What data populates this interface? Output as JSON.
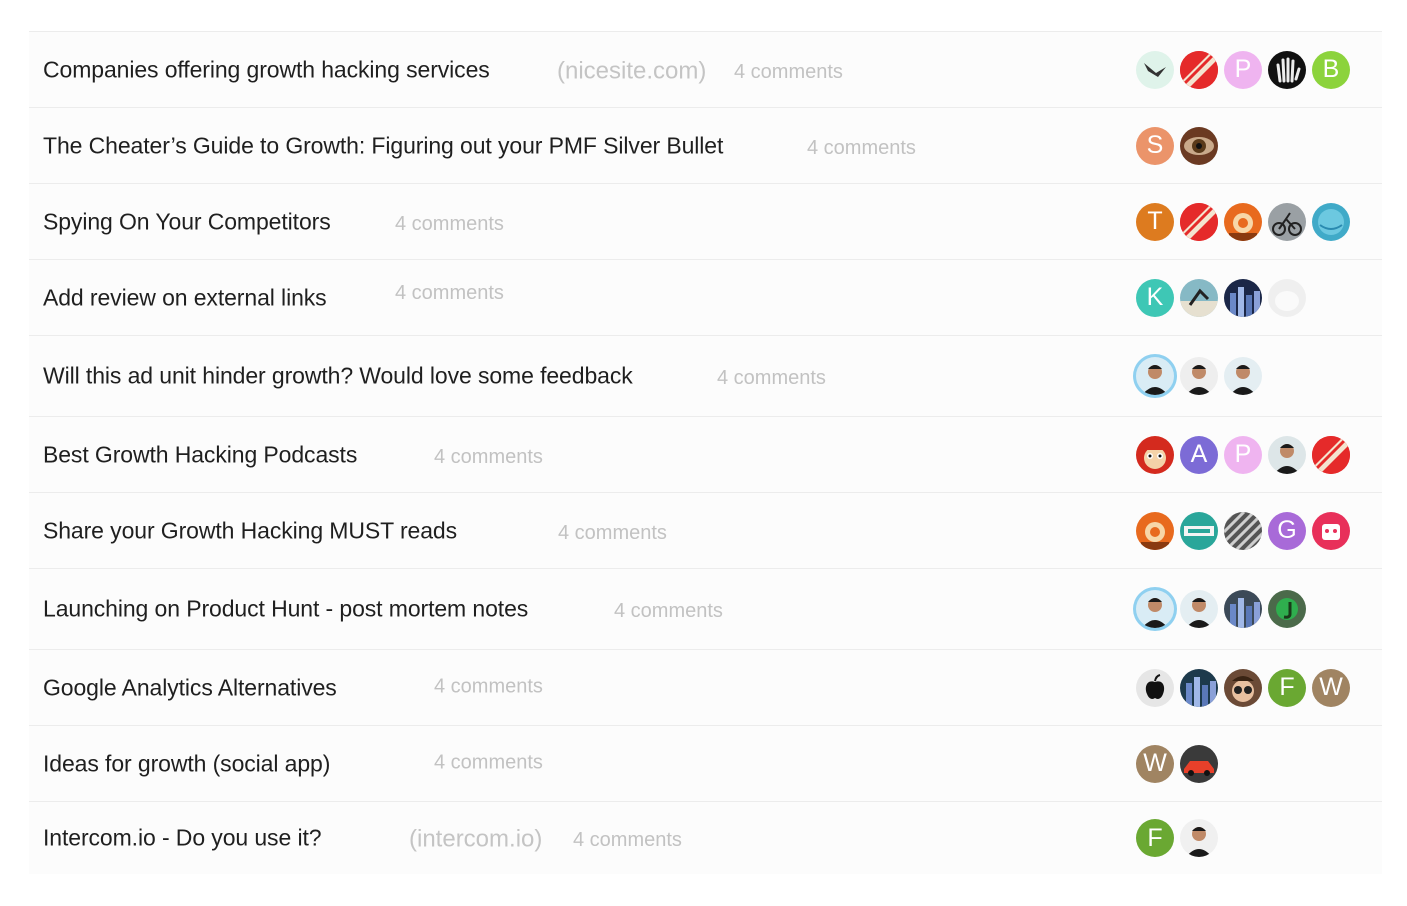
{
  "threads": [
    {
      "title": "Companies offering growth hacking services",
      "domain": "(nicesite.com)",
      "comments": "4 comments",
      "avatars": [
        {
          "kind": "bird-avatar",
          "bg": "#dff3ea"
        },
        {
          "kind": "red-stripe-avatar",
          "bg": "#e52a2a"
        },
        {
          "kind": "letter",
          "letter": "P",
          "bg": "#efb4f0"
        },
        {
          "kind": "hand-avatar",
          "bg": "#111111"
        },
        {
          "kind": "letter",
          "letter": "B",
          "bg": "#8cd33c"
        }
      ]
    },
    {
      "title": "The Cheater’s Guide to Growth: Figuring out your PMF Silver Bullet",
      "domain": "",
      "comments": "4 comments",
      "avatars": [
        {
          "kind": "letter",
          "letter": "S",
          "bg": "#eb946a"
        },
        {
          "kind": "eye-avatar",
          "bg": "#6b3a22"
        }
      ]
    },
    {
      "title": "Spying On Your Competitors",
      "domain": "",
      "comments": "4 comments",
      "avatars": [
        {
          "kind": "letter",
          "letter": "T",
          "bg": "#dd7b1f"
        },
        {
          "kind": "red-stripe-avatar",
          "bg": "#e52a2a"
        },
        {
          "kind": "cartoon-avatar",
          "bg": "#e86a1e"
        },
        {
          "kind": "cyclist-avatar",
          "bg": "#9aa0a4"
        },
        {
          "kind": "blue-circle-avatar",
          "bg": "#40aac8"
        }
      ]
    },
    {
      "title": "Add review on external links",
      "domain": "",
      "comments": "4 comments",
      "avatars": [
        {
          "kind": "letter",
          "letter": "K",
          "bg": "#3ec7b5"
        },
        {
          "kind": "surfer-avatar",
          "bg": "#86b9c5"
        },
        {
          "kind": "city-avatar",
          "bg": "#1b2748"
        },
        {
          "kind": "white-avatar",
          "bg": "#efefef"
        }
      ]
    },
    {
      "title": "Will this ad unit hinder growth? Would love some feedback",
      "domain": "",
      "comments": "4 comments",
      "avatars": [
        {
          "kind": "person-avatar",
          "bg": "#d9ecf5",
          "ring": true
        },
        {
          "kind": "person-avatar",
          "bg": "#eeeeee"
        },
        {
          "kind": "person-avatar",
          "bg": "#e4eef2"
        }
      ]
    },
    {
      "title": "Best Growth Hacking Podcasts",
      "domain": "",
      "comments": "4 comments",
      "avatars": [
        {
          "kind": "mario-avatar",
          "bg": "#d42a1e"
        },
        {
          "kind": "letter",
          "letter": "A",
          "bg": "#7c6bd6"
        },
        {
          "kind": "letter",
          "letter": "P",
          "bg": "#efb4f0"
        },
        {
          "kind": "person-avatar",
          "bg": "#dde6e8"
        },
        {
          "kind": "red-stripe-avatar",
          "bg": "#e52a2a"
        }
      ]
    },
    {
      "title": "Share your Growth Hacking MUST reads",
      "domain": "",
      "comments": "4 comments",
      "avatars": [
        {
          "kind": "cartoon-avatar",
          "bg": "#e86a1e"
        },
        {
          "kind": "badge-avatar",
          "bg": "#2aa69a"
        },
        {
          "kind": "pattern-avatar",
          "bg": "#555555"
        },
        {
          "kind": "letter",
          "letter": "G",
          "bg": "#a86ad8"
        },
        {
          "kind": "robot-avatar",
          "bg": "#e8305a"
        }
      ]
    },
    {
      "title": "Launching on Product Hunt - post mortem notes",
      "domain": "",
      "comments": "4 comments",
      "avatars": [
        {
          "kind": "person-avatar",
          "bg": "#d9ecf5",
          "ring": true
        },
        {
          "kind": "person-avatar",
          "bg": "#e4eef2"
        },
        {
          "kind": "city-avatar",
          "bg": "#3c4a58"
        },
        {
          "kind": "j-avatar",
          "bg": "#4b6a4a"
        }
      ]
    },
    {
      "title": "Google Analytics Alternatives",
      "domain": "",
      "comments": "4 comments",
      "avatars": [
        {
          "kind": "apple-avatar",
          "bg": "#e6e6e6"
        },
        {
          "kind": "city-avatar",
          "bg": "#1d3a4c"
        },
        {
          "kind": "glasses-avatar",
          "bg": "#6b4a36"
        },
        {
          "kind": "letter",
          "letter": "F",
          "bg": "#6aa832"
        },
        {
          "kind": "letter",
          "letter": "W",
          "bg": "#a08462"
        }
      ]
    },
    {
      "title": "Ideas for growth (social app)",
      "domain": "",
      "comments": "4 comments",
      "avatars": [
        {
          "kind": "letter",
          "letter": "W",
          "bg": "#a08462"
        },
        {
          "kind": "car-avatar",
          "bg": "#3a3a3a"
        }
      ]
    },
    {
      "title": "Intercom.io - Do you use it?",
      "domain": "(intercom.io)",
      "comments": "4 comments",
      "avatars": [
        {
          "kind": "letter",
          "letter": "F",
          "bg": "#6aa832"
        },
        {
          "kind": "person-avatar",
          "bg": "#f0f0f0"
        }
      ]
    }
  ]
}
